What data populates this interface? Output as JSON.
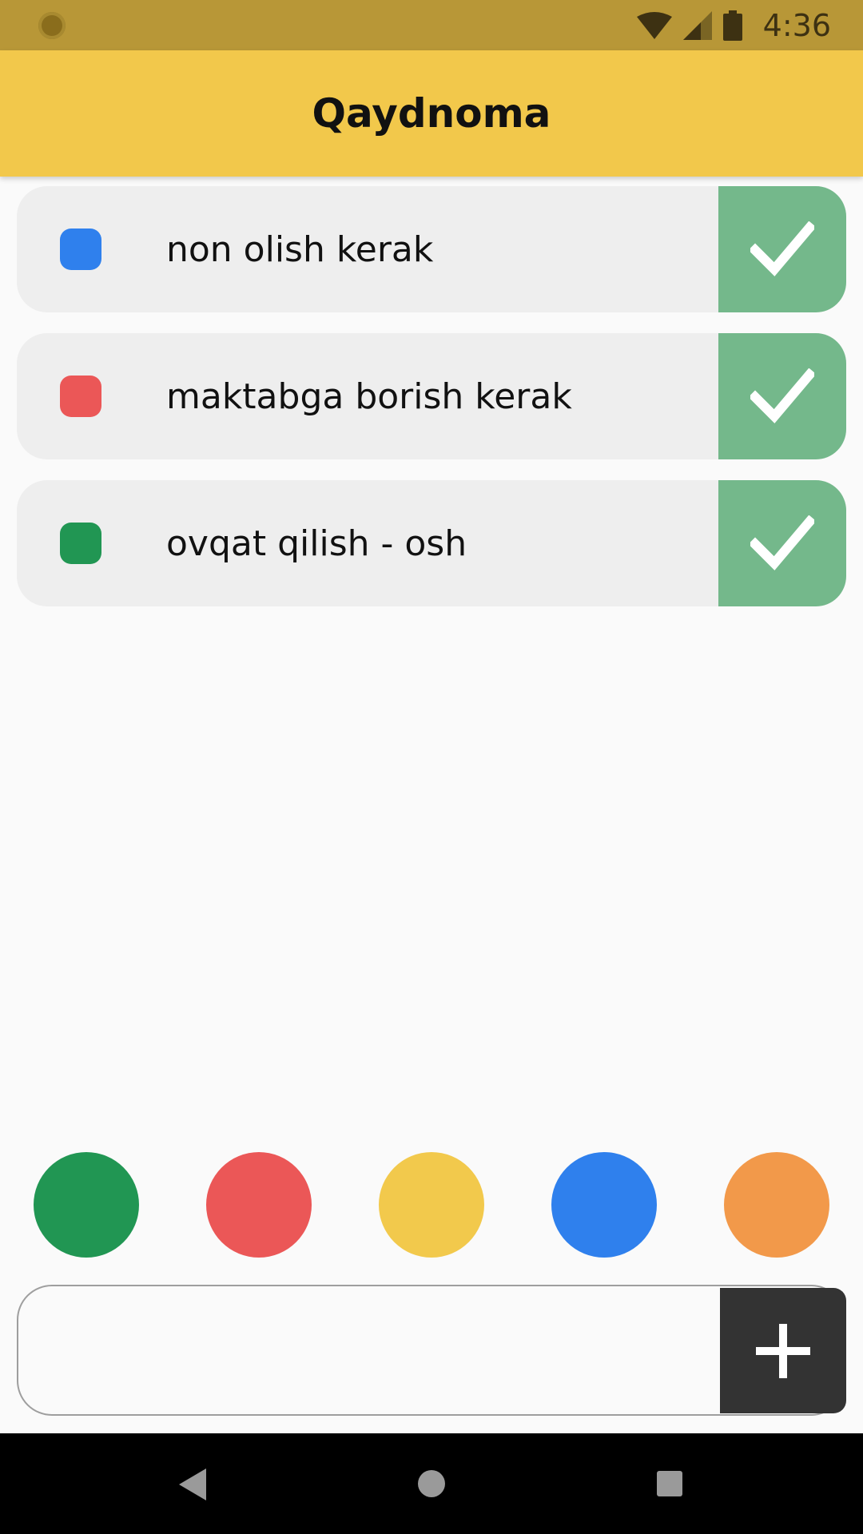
{
  "status_bar": {
    "time": "4:36",
    "icons": [
      "notification-icon",
      "wifi-icon",
      "signal-icon",
      "battery-icon"
    ]
  },
  "app_bar": {
    "title": "Qaydnoma"
  },
  "todos": [
    {
      "text": "non olish kerak",
      "color": "#2f80ed",
      "done_icon": "check-icon"
    },
    {
      "text": "maktabga borish kerak",
      "color": "#eb5757",
      "done_icon": "check-icon"
    },
    {
      "text": "ovqat qilish - osh",
      "color": "#219653",
      "done_icon": "check-icon"
    }
  ],
  "color_picker": {
    "colors": [
      "#219653",
      "#eb5757",
      "#f2c94c",
      "#2f80ed",
      "#f2994a"
    ]
  },
  "new_todo": {
    "value": "",
    "placeholder": "",
    "add_icon": "plus-icon"
  },
  "nav_bar": {
    "icons": [
      "back-icon",
      "home-icon",
      "recents-icon"
    ]
  },
  "colors": {
    "status_bar": "#b89737",
    "app_bar": "#f2c84b",
    "item_bg": "#eeeeee",
    "check_bg": "#74b88b",
    "add_button_bg": "#333333"
  }
}
